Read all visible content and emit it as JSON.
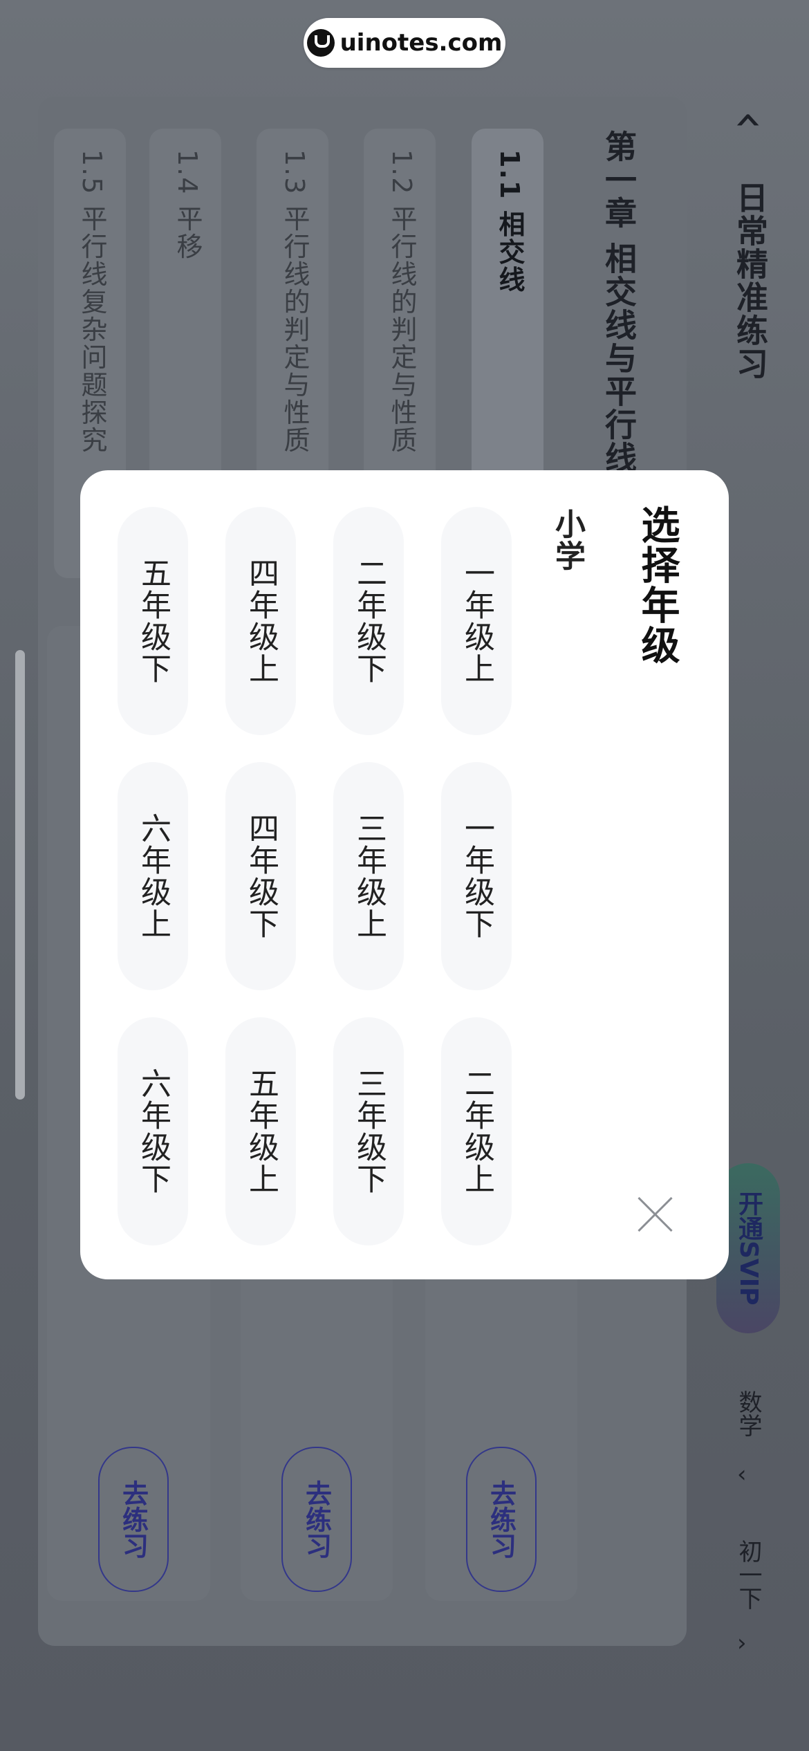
{
  "watermark": {
    "text": "uinotes.com"
  },
  "header": {
    "back_icon": "chevron-left-icon",
    "title": "日常精准练习",
    "svip_label": "开通SVIP",
    "subject": "数学",
    "grade": "初一下"
  },
  "chapter": {
    "title": "第一章 相交线与平行线",
    "lessons": [
      {
        "label": "1.1 相交线",
        "active": true
      },
      {
        "label": "1.2 平行线的判定与性质"
      },
      {
        "label": "1.3 平行线的判定与性质"
      },
      {
        "label": "1.4 平移"
      },
      {
        "label": "1.5 平行线复杂问题探究"
      }
    ]
  },
  "cards": {
    "go_label": "去练习"
  },
  "modal": {
    "title": "选择年级",
    "section": "小学",
    "options": [
      "一年级上",
      "一年级下",
      "二年级上",
      "二年级下",
      "三年级上",
      "三年级下",
      "四年级上",
      "四年级下",
      "五年级上",
      "五年级下",
      "六年级上",
      "六年级下"
    ],
    "close_icon": "close-icon"
  }
}
